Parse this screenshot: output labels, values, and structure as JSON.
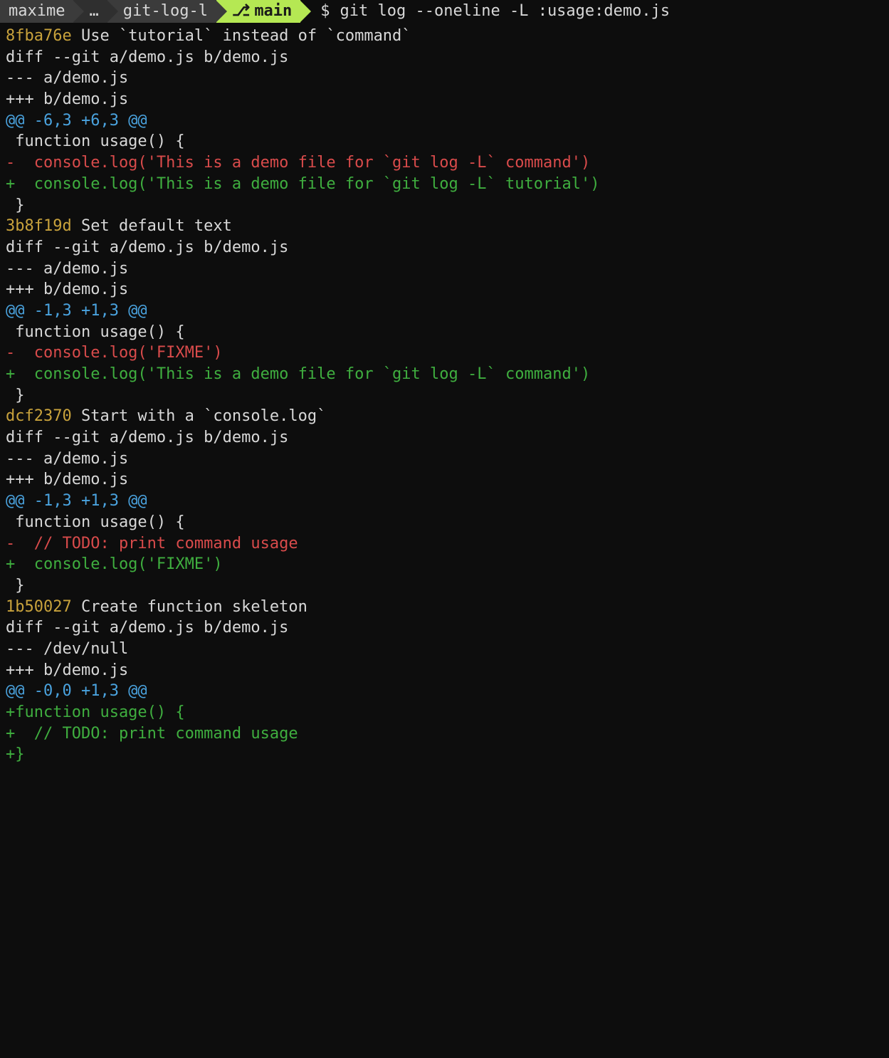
{
  "prompt": {
    "user": "maxime",
    "ellipsis": "…",
    "dir": "git-log-l",
    "branch_icon": "⎇",
    "branch": "main",
    "symbol": "$",
    "command": "git log --oneline -L :usage:demo.js"
  },
  "commits": [
    {
      "hash": "8fba76e",
      "msg": "Use `tutorial` instead of `command`",
      "diff_header": "diff --git a/demo.js b/demo.js",
      "minus_file": "--- a/demo.js",
      "plus_file": "+++ b/demo.js",
      "hunk": "@@ -6,3 +6,3 @@",
      "lines": [
        {
          "t": "ctx",
          "text": " function usage() {"
        },
        {
          "t": "del",
          "text": "-  console.log('This is a demo file for `git log -L` command')"
        },
        {
          "t": "add",
          "text": "+  console.log('This is a demo file for `git log -L` tutorial')"
        },
        {
          "t": "ctx",
          "text": " }"
        }
      ]
    },
    {
      "hash": "3b8f19d",
      "msg": "Set default text",
      "diff_header": "diff --git a/demo.js b/demo.js",
      "minus_file": "--- a/demo.js",
      "plus_file": "+++ b/demo.js",
      "hunk": "@@ -1,3 +1,3 @@",
      "lines": [
        {
          "t": "ctx",
          "text": " function usage() {"
        },
        {
          "t": "del",
          "text": "-  console.log('FIXME')"
        },
        {
          "t": "add",
          "text": "+  console.log('This is a demo file for `git log -L` command')"
        },
        {
          "t": "ctx",
          "text": " }"
        }
      ]
    },
    {
      "hash": "dcf2370",
      "msg": "Start with a `console.log`",
      "diff_header": "diff --git a/demo.js b/demo.js",
      "minus_file": "--- a/demo.js",
      "plus_file": "+++ b/demo.js",
      "hunk": "@@ -1,3 +1,3 @@",
      "lines": [
        {
          "t": "ctx",
          "text": " function usage() {"
        },
        {
          "t": "del",
          "text": "-  // TODO: print command usage"
        },
        {
          "t": "add",
          "text": "+  console.log('FIXME')"
        },
        {
          "t": "ctx",
          "text": " }"
        }
      ]
    },
    {
      "hash": "1b50027",
      "msg": "Create function skeleton",
      "diff_header": "diff --git a/demo.js b/demo.js",
      "minus_file": "--- /dev/null",
      "plus_file": "+++ b/demo.js",
      "hunk": "@@ -0,0 +1,3 @@",
      "lines": [
        {
          "t": "add",
          "text": "+function usage() {"
        },
        {
          "t": "add",
          "text": "+  // TODO: print command usage"
        },
        {
          "t": "add",
          "text": "+}"
        }
      ]
    }
  ]
}
